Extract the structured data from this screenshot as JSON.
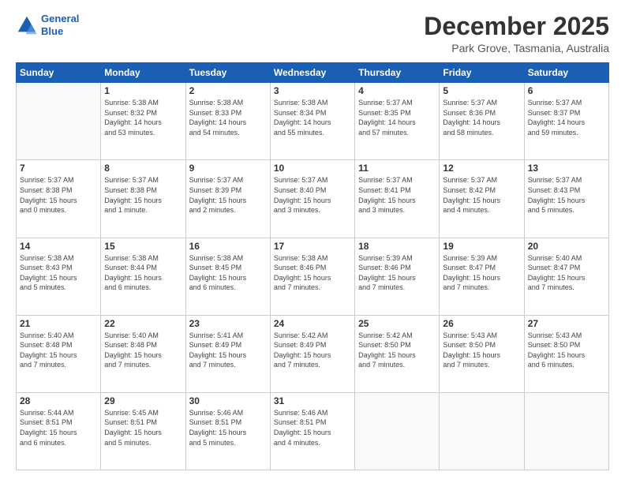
{
  "header": {
    "logo_line1": "General",
    "logo_line2": "Blue",
    "month": "December 2025",
    "location": "Park Grove, Tasmania, Australia"
  },
  "days_of_week": [
    "Sunday",
    "Monday",
    "Tuesday",
    "Wednesday",
    "Thursday",
    "Friday",
    "Saturday"
  ],
  "weeks": [
    [
      {
        "day": "",
        "info": ""
      },
      {
        "day": "1",
        "info": "Sunrise: 5:38 AM\nSunset: 8:32 PM\nDaylight: 14 hours\nand 53 minutes."
      },
      {
        "day": "2",
        "info": "Sunrise: 5:38 AM\nSunset: 8:33 PM\nDaylight: 14 hours\nand 54 minutes."
      },
      {
        "day": "3",
        "info": "Sunrise: 5:38 AM\nSunset: 8:34 PM\nDaylight: 14 hours\nand 55 minutes."
      },
      {
        "day": "4",
        "info": "Sunrise: 5:37 AM\nSunset: 8:35 PM\nDaylight: 14 hours\nand 57 minutes."
      },
      {
        "day": "5",
        "info": "Sunrise: 5:37 AM\nSunset: 8:36 PM\nDaylight: 14 hours\nand 58 minutes."
      },
      {
        "day": "6",
        "info": "Sunrise: 5:37 AM\nSunset: 8:37 PM\nDaylight: 14 hours\nand 59 minutes."
      }
    ],
    [
      {
        "day": "7",
        "info": "Sunrise: 5:37 AM\nSunset: 8:38 PM\nDaylight: 15 hours\nand 0 minutes."
      },
      {
        "day": "8",
        "info": "Sunrise: 5:37 AM\nSunset: 8:38 PM\nDaylight: 15 hours\nand 1 minute."
      },
      {
        "day": "9",
        "info": "Sunrise: 5:37 AM\nSunset: 8:39 PM\nDaylight: 15 hours\nand 2 minutes."
      },
      {
        "day": "10",
        "info": "Sunrise: 5:37 AM\nSunset: 8:40 PM\nDaylight: 15 hours\nand 3 minutes."
      },
      {
        "day": "11",
        "info": "Sunrise: 5:37 AM\nSunset: 8:41 PM\nDaylight: 15 hours\nand 3 minutes."
      },
      {
        "day": "12",
        "info": "Sunrise: 5:37 AM\nSunset: 8:42 PM\nDaylight: 15 hours\nand 4 minutes."
      },
      {
        "day": "13",
        "info": "Sunrise: 5:37 AM\nSunset: 8:43 PM\nDaylight: 15 hours\nand 5 minutes."
      }
    ],
    [
      {
        "day": "14",
        "info": "Sunrise: 5:38 AM\nSunset: 8:43 PM\nDaylight: 15 hours\nand 5 minutes."
      },
      {
        "day": "15",
        "info": "Sunrise: 5:38 AM\nSunset: 8:44 PM\nDaylight: 15 hours\nand 6 minutes."
      },
      {
        "day": "16",
        "info": "Sunrise: 5:38 AM\nSunset: 8:45 PM\nDaylight: 15 hours\nand 6 minutes."
      },
      {
        "day": "17",
        "info": "Sunrise: 5:38 AM\nSunset: 8:46 PM\nDaylight: 15 hours\nand 7 minutes."
      },
      {
        "day": "18",
        "info": "Sunrise: 5:39 AM\nSunset: 8:46 PM\nDaylight: 15 hours\nand 7 minutes."
      },
      {
        "day": "19",
        "info": "Sunrise: 5:39 AM\nSunset: 8:47 PM\nDaylight: 15 hours\nand 7 minutes."
      },
      {
        "day": "20",
        "info": "Sunrise: 5:40 AM\nSunset: 8:47 PM\nDaylight: 15 hours\nand 7 minutes."
      }
    ],
    [
      {
        "day": "21",
        "info": "Sunrise: 5:40 AM\nSunset: 8:48 PM\nDaylight: 15 hours\nand 7 minutes."
      },
      {
        "day": "22",
        "info": "Sunrise: 5:40 AM\nSunset: 8:48 PM\nDaylight: 15 hours\nand 7 minutes."
      },
      {
        "day": "23",
        "info": "Sunrise: 5:41 AM\nSunset: 8:49 PM\nDaylight: 15 hours\nand 7 minutes."
      },
      {
        "day": "24",
        "info": "Sunrise: 5:42 AM\nSunset: 8:49 PM\nDaylight: 15 hours\nand 7 minutes."
      },
      {
        "day": "25",
        "info": "Sunrise: 5:42 AM\nSunset: 8:50 PM\nDaylight: 15 hours\nand 7 minutes."
      },
      {
        "day": "26",
        "info": "Sunrise: 5:43 AM\nSunset: 8:50 PM\nDaylight: 15 hours\nand 7 minutes."
      },
      {
        "day": "27",
        "info": "Sunrise: 5:43 AM\nSunset: 8:50 PM\nDaylight: 15 hours\nand 6 minutes."
      }
    ],
    [
      {
        "day": "28",
        "info": "Sunrise: 5:44 AM\nSunset: 8:51 PM\nDaylight: 15 hours\nand 6 minutes."
      },
      {
        "day": "29",
        "info": "Sunrise: 5:45 AM\nSunset: 8:51 PM\nDaylight: 15 hours\nand 5 minutes."
      },
      {
        "day": "30",
        "info": "Sunrise: 5:46 AM\nSunset: 8:51 PM\nDaylight: 15 hours\nand 5 minutes."
      },
      {
        "day": "31",
        "info": "Sunrise: 5:46 AM\nSunset: 8:51 PM\nDaylight: 15 hours\nand 4 minutes."
      },
      {
        "day": "",
        "info": ""
      },
      {
        "day": "",
        "info": ""
      },
      {
        "day": "",
        "info": ""
      }
    ]
  ]
}
